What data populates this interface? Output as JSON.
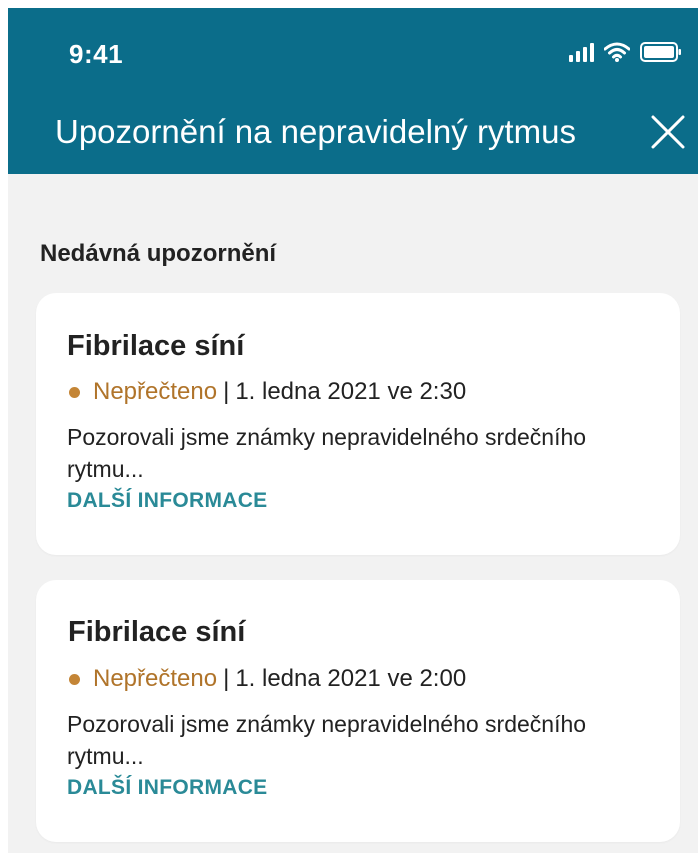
{
  "status_bar": {
    "time": "9:41",
    "icons": [
      "cellular-signal-icon",
      "wifi-icon",
      "battery-icon"
    ]
  },
  "header": {
    "title": "Upozornění na nepravidelný rytmus",
    "close_icon": "close-icon",
    "background": "#0b6d8a"
  },
  "section": {
    "heading": "Nedávná upozornění"
  },
  "alerts": [
    {
      "title": "Fibrilace síní",
      "status": "Nepřečteno",
      "separator": "|",
      "datetime": "1. ledna 2021 ve 2:30",
      "description": "Pozorovali jsme známky nepravidelného srdečního rytmu...",
      "link": "DALŠÍ INFORMACE"
    },
    {
      "title": "Fibrilace síní",
      "status": "Nepřečteno",
      "separator": "|",
      "datetime": "1. ledna 2021 ve 2:00",
      "description": "Pozorovali jsme známky nepravidelného srdečního rytmu...",
      "link": "DALŠÍ INFORMACE"
    }
  ],
  "colors": {
    "accent": "#2a8a97",
    "unread": "#b0742a",
    "page_background": "#f2f2f2"
  }
}
